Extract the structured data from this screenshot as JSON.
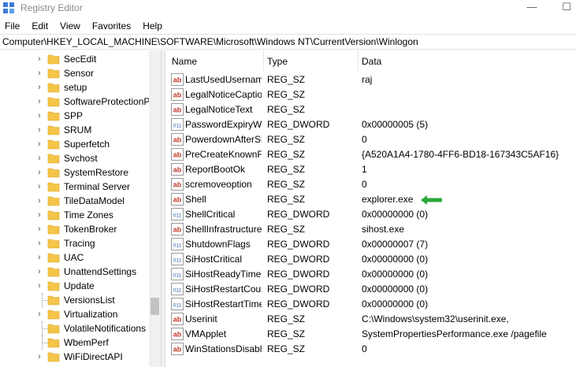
{
  "window": {
    "title": "Registry Editor",
    "minimize_glyph": "—",
    "maximize_glyph": "☐"
  },
  "menu": [
    "File",
    "Edit",
    "View",
    "Favorites",
    "Help"
  ],
  "address": "Computer\\HKEY_LOCAL_MACHINE\\SOFTWARE\\Microsoft\\Windows NT\\CurrentVersion\\Winlogon",
  "tree": [
    {
      "label": "SecEdit",
      "expandable": true
    },
    {
      "label": "Sensor",
      "expandable": true
    },
    {
      "label": "setup",
      "expandable": true
    },
    {
      "label": "SoftwareProtectionPlatform",
      "expandable": true
    },
    {
      "label": "SPP",
      "expandable": true
    },
    {
      "label": "SRUM",
      "expandable": true
    },
    {
      "label": "Superfetch",
      "expandable": true
    },
    {
      "label": "Svchost",
      "expandable": true
    },
    {
      "label": "SystemRestore",
      "expandable": true
    },
    {
      "label": "Terminal Server",
      "expandable": true
    },
    {
      "label": "TileDataModel",
      "expandable": true
    },
    {
      "label": "Time Zones",
      "expandable": true
    },
    {
      "label": "TokenBroker",
      "expandable": true
    },
    {
      "label": "Tracing",
      "expandable": true
    },
    {
      "label": "UAC",
      "expandable": true
    },
    {
      "label": "UnattendSettings",
      "expandable": true
    },
    {
      "label": "Update",
      "expandable": true
    },
    {
      "label": "VersionsList",
      "expandable": false
    },
    {
      "label": "Virtualization",
      "expandable": true
    },
    {
      "label": "VolatileNotifications",
      "expandable": false
    },
    {
      "label": "WbemPerf",
      "expandable": false
    },
    {
      "label": "WiFiDirectAPI",
      "expandable": true
    }
  ],
  "columns": {
    "name": "Name",
    "type": "Type",
    "data": "Data"
  },
  "values": [
    {
      "icon": "string-value-icon",
      "name": "LastUsedUsername",
      "type": "REG_SZ",
      "data": "raj"
    },
    {
      "icon": "string-value-icon",
      "name": "LegalNoticeCaption",
      "type": "REG_SZ",
      "data": ""
    },
    {
      "icon": "string-value-icon",
      "name": "LegalNoticeText",
      "type": "REG_SZ",
      "data": ""
    },
    {
      "icon": "binary-value-icon",
      "name": "PasswordExpiryWarning",
      "type": "REG_DWORD",
      "data": "0x00000005 (5)"
    },
    {
      "icon": "string-value-icon",
      "name": "PowerdownAfterShutdown",
      "type": "REG_SZ",
      "data": "0"
    },
    {
      "icon": "string-value-icon",
      "name": "PreCreateKnownFolders",
      "type": "REG_SZ",
      "data": "{A520A1A4-1780-4FF6-BD18-167343C5AF16}"
    },
    {
      "icon": "string-value-icon",
      "name": "ReportBootOk",
      "type": "REG_SZ",
      "data": "1"
    },
    {
      "icon": "string-value-icon",
      "name": "scremoveoption",
      "type": "REG_SZ",
      "data": "0"
    },
    {
      "icon": "string-value-icon",
      "name": "Shell",
      "type": "REG_SZ",
      "data": "explorer.exe",
      "highlight_arrow": true
    },
    {
      "icon": "binary-value-icon",
      "name": "ShellCritical",
      "type": "REG_DWORD",
      "data": "0x00000000 (0)"
    },
    {
      "icon": "string-value-icon",
      "name": "ShellInfrastructure",
      "type": "REG_SZ",
      "data": "sihost.exe"
    },
    {
      "icon": "binary-value-icon",
      "name": "ShutdownFlags",
      "type": "REG_DWORD",
      "data": "0x00000007 (7)"
    },
    {
      "icon": "binary-value-icon",
      "name": "SiHostCritical",
      "type": "REG_DWORD",
      "data": "0x00000000 (0)"
    },
    {
      "icon": "binary-value-icon",
      "name": "SiHostReadyTimeOut",
      "type": "REG_DWORD",
      "data": "0x00000000 (0)"
    },
    {
      "icon": "binary-value-icon",
      "name": "SiHostRestartCountLimit",
      "type": "REG_DWORD",
      "data": "0x00000000 (0)"
    },
    {
      "icon": "binary-value-icon",
      "name": "SiHostRestartTimeGap",
      "type": "REG_DWORD",
      "data": "0x00000000 (0)"
    },
    {
      "icon": "string-value-icon",
      "name": "Userinit",
      "type": "REG_SZ",
      "data": "C:\\Windows\\system32\\userinit.exe,"
    },
    {
      "icon": "string-value-icon",
      "name": "VMApplet",
      "type": "REG_SZ",
      "data": "SystemPropertiesPerformance.exe /pagefile"
    },
    {
      "icon": "string-value-icon",
      "name": "WinStationsDisabled",
      "type": "REG_SZ",
      "data": "0"
    }
  ],
  "colors": {
    "folder": "#f5c54a",
    "arrow": "#2ea83a",
    "string_icon_red": "#c0392b",
    "binary_icon_blue": "#2b5fb3"
  }
}
